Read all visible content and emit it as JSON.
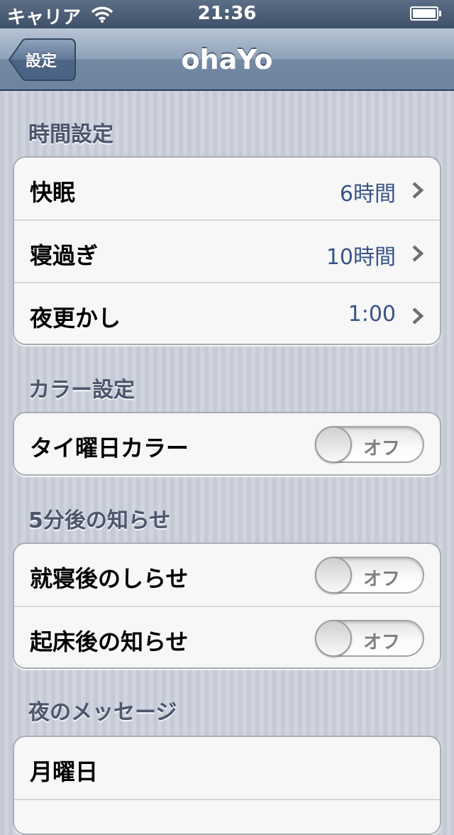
{
  "status_bar": {
    "carrier": "キャリア",
    "time": "21:36",
    "wifi_icon": "wifi-icon",
    "battery_icon": "battery-icon"
  },
  "nav_bar": {
    "title": "ohaYo",
    "back_label": "設定"
  },
  "sections": {
    "time_settings": {
      "header": "時間設定",
      "rows": [
        {
          "label": "快眠",
          "value": "6時間"
        },
        {
          "label": "寝過ぎ",
          "value": "10時間"
        },
        {
          "label": "夜更かし",
          "value": "1:00"
        }
      ]
    },
    "color_settings": {
      "header": "カラー設定",
      "rows": [
        {
          "label": "タイ曜日カラー",
          "switch": "オフ"
        }
      ]
    },
    "notify_5min": {
      "header": "5分後の知らせ",
      "rows": [
        {
          "label": "就寝後のしらせ",
          "switch": "オフ"
        },
        {
          "label": "起床後の知らせ",
          "switch": "オフ"
        }
      ]
    },
    "night_messages": {
      "header": "夜のメッセージ",
      "rows": [
        {
          "label": "月曜日"
        }
      ]
    }
  },
  "colors": {
    "value_text": "#385487",
    "section_header": "#4c566c",
    "nav_bar": "#7489a3"
  }
}
